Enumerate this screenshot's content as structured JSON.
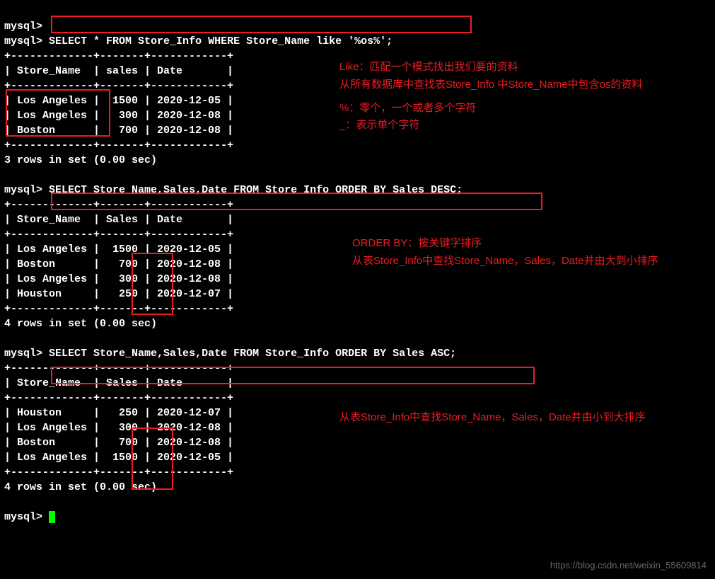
{
  "prompts": {
    "p0": "mysql>",
    "p1": "mysql>"
  },
  "queries": {
    "q1": "SELECT * FROM Store_Info WHERE Store_Name like '%os%';",
    "q2": "SELECT Store_Name,Sales,Date FROM Store_Info ORDER BY Sales DESC;",
    "q3": "SELECT Store_Name,Sales,Date FROM Store_Info ORDER BY Sales ASC;"
  },
  "separators": {
    "t1": "+-------------+-------+------------+",
    "t2": "+-------------+-------+------------+"
  },
  "headers": {
    "t1": "| Store_Name  | sales | Date       |",
    "t2": "| Store_Name  | Sales | Date       |"
  },
  "table1": {
    "rows": [
      "| Los Angeles |  1500 | 2020-12-05 |",
      "| Los Angeles |   300 | 2020-12-08 |",
      "| Boston      |   700 | 2020-12-08 |"
    ],
    "footer": "3 rows in set (0.00 sec)"
  },
  "table2": {
    "rows": [
      "| Los Angeles |  1500 | 2020-12-05 |",
      "| Boston      |   700 | 2020-12-08 |",
      "| Los Angeles |   300 | 2020-12-08 |",
      "| Houston     |   250 | 2020-12-07 |"
    ],
    "footer": "4 rows in set (0.00 sec)"
  },
  "table3": {
    "rows": [
      "| Houston     |   250 | 2020-12-07 |",
      "| Los Angeles |   300 | 2020-12-08 |",
      "| Boston      |   700 | 2020-12-08 |",
      "| Los Angeles |  1500 | 2020-12-05 |"
    ],
    "footer": "4 rows in set (0.00 sec)"
  },
  "annotations": {
    "a1_line1": "Like：匹配一个模式找出我们要的资料",
    "a1_line2": "从所有数据库中查找表Store_Info 中Store_Name中包含os的资料",
    "a1_line3": "%：零个，一个或者多个字符",
    "a1_line4": "_：表示单个字符",
    "a2_line1": "ORDER BY：按关键字排序",
    "a2_line2": "从表Store_Info中查找Store_Name，Sales，Date并由大到小排序",
    "a3_line1": "从表Store_Info中查找Store_Name，Sales，Date并由小到大排序"
  },
  "watermark": "https://blog.csdn.net/weixin_55609814"
}
